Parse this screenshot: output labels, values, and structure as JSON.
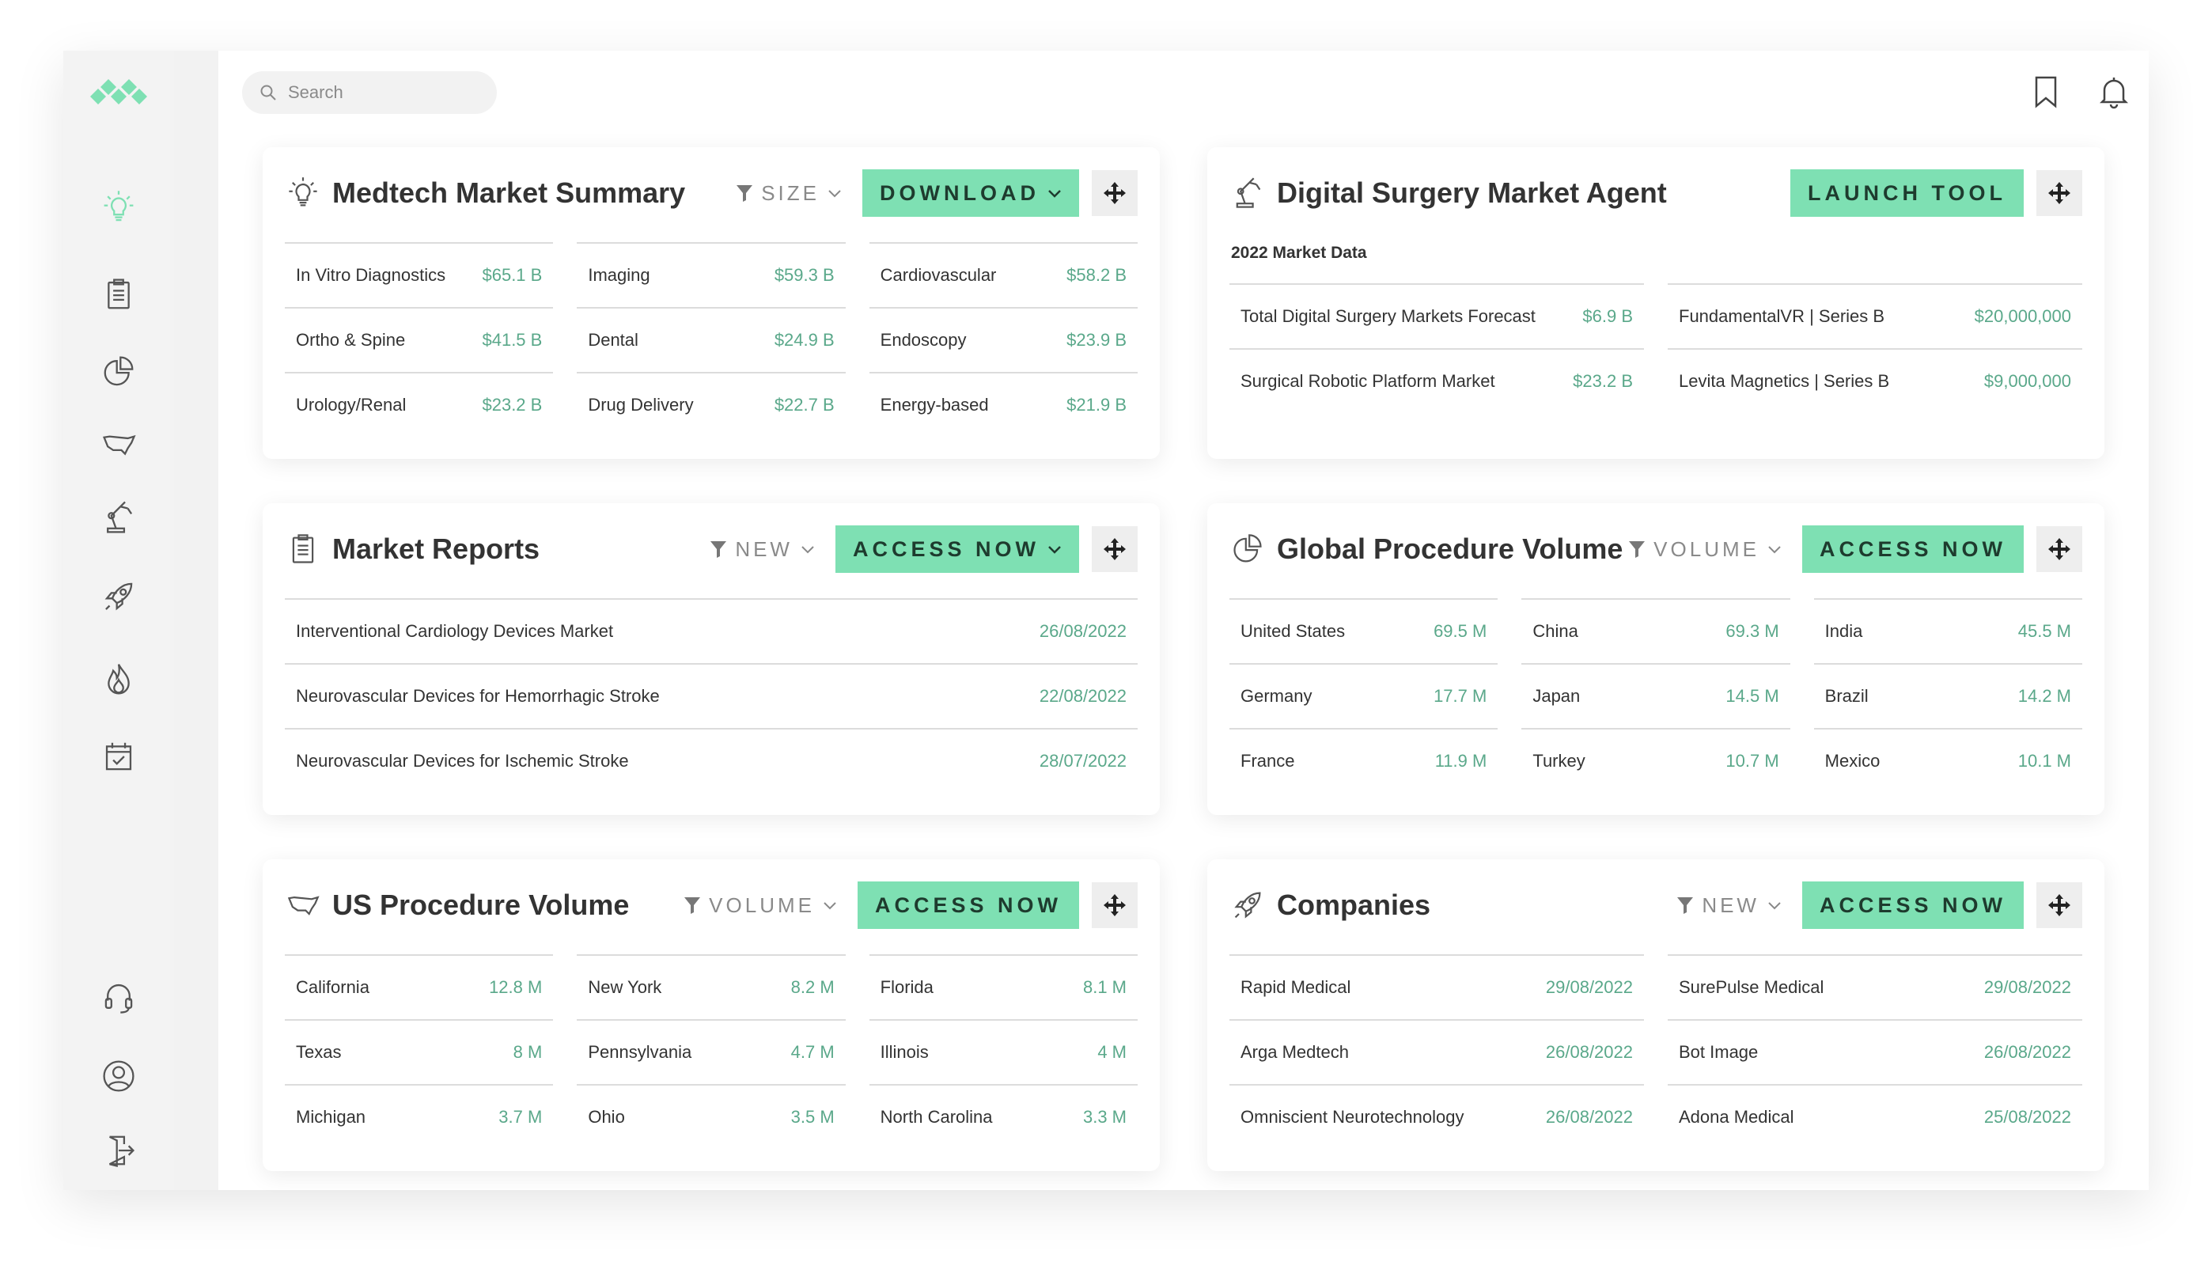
{
  "search": {
    "placeholder": "Search"
  },
  "brand_color": "#7ee0b3",
  "value_color": "#5aa88a",
  "sidebar": {
    "items": [
      {
        "icon": "lightbulb-icon"
      },
      {
        "icon": "clipboard-icon"
      },
      {
        "icon": "pie-chart-icon"
      },
      {
        "icon": "us-map-icon"
      },
      {
        "icon": "robot-arm-icon"
      },
      {
        "icon": "rocket-icon"
      },
      {
        "icon": "flame-icon"
      },
      {
        "icon": "calendar-check-icon"
      }
    ],
    "bottom": [
      {
        "icon": "headset-icon"
      },
      {
        "icon": "user-icon"
      },
      {
        "icon": "logout-icon"
      }
    ]
  },
  "header": {
    "icons": [
      "bookmark-icon",
      "bell-icon"
    ]
  },
  "cards": {
    "summary": {
      "title": "Medtech Market Summary",
      "filter": "SIZE",
      "button": "DOWNLOAD",
      "rows": [
        [
          {
            "label": "In Vitro Diagnostics",
            "value": "$65.1 B"
          },
          {
            "label": "Imaging",
            "value": "$59.3 B"
          },
          {
            "label": "Cardiovascular",
            "value": "$58.2 B"
          }
        ],
        [
          {
            "label": "Ortho & Spine",
            "value": "$41.5 B"
          },
          {
            "label": "Dental",
            "value": "$24.9 B"
          },
          {
            "label": "Endoscopy",
            "value": "$23.9 B"
          }
        ],
        [
          {
            "label": "Urology/Renal",
            "value": "$23.2 B"
          },
          {
            "label": "Drug Delivery",
            "value": "$22.7 B"
          },
          {
            "label": "Energy-based",
            "value": "$21.9 B"
          }
        ]
      ]
    },
    "surgery": {
      "title": "Digital Surgery Market Agent",
      "button": "LAUNCH TOOL",
      "subtitle": "2022 Market Data",
      "rows": [
        [
          {
            "label": "Total Digital Surgery Markets Forecast",
            "value": "$6.9 B"
          },
          {
            "label": "FundamentalVR | Series B",
            "value": "$20,000,000"
          }
        ],
        [
          {
            "label": "Surgical Robotic Platform Market",
            "value": "$23.2 B"
          },
          {
            "label": "Levita Magnetics | Series B",
            "value": "$9,000,000"
          }
        ]
      ]
    },
    "reports": {
      "title": "Market Reports",
      "filter": "NEW",
      "button": "ACCESS NOW",
      "rows": [
        [
          {
            "label": "Interventional Cardiology Devices Market",
            "value": "26/08/2022"
          }
        ],
        [
          {
            "label": "Neurovascular Devices for Hemorrhagic Stroke",
            "value": "22/08/2022"
          }
        ],
        [
          {
            "label": "Neurovascular Devices for Ischemic Stroke",
            "value": "28/07/2022"
          }
        ]
      ]
    },
    "global": {
      "title": "Global Procedure Volume",
      "filter": "VOLUME",
      "button": "ACCESS NOW",
      "rows": [
        [
          {
            "label": "United States",
            "value": "69.5 M"
          },
          {
            "label": "China",
            "value": "69.3 M"
          },
          {
            "label": "India",
            "value": "45.5 M"
          }
        ],
        [
          {
            "label": "Germany",
            "value": "17.7 M"
          },
          {
            "label": "Japan",
            "value": "14.5 M"
          },
          {
            "label": "Brazil",
            "value": "14.2 M"
          }
        ],
        [
          {
            "label": "France",
            "value": "11.9 M"
          },
          {
            "label": "Turkey",
            "value": "10.7 M"
          },
          {
            "label": "Mexico",
            "value": "10.1 M"
          }
        ]
      ]
    },
    "us": {
      "title": "US Procedure Volume",
      "filter": "VOLUME",
      "button": "ACCESS NOW",
      "rows": [
        [
          {
            "label": "California",
            "value": "12.8 M"
          },
          {
            "label": "New York",
            "value": "8.2 M"
          },
          {
            "label": "Florida",
            "value": "8.1 M"
          }
        ],
        [
          {
            "label": "Texas",
            "value": "8 M"
          },
          {
            "label": "Pennsylvania",
            "value": "4.7 M"
          },
          {
            "label": "Illinois",
            "value": "4 M"
          }
        ],
        [
          {
            "label": "Michigan",
            "value": "3.7 M"
          },
          {
            "label": "Ohio",
            "value": "3.5 M"
          },
          {
            "label": "North Carolina",
            "value": "3.3 M"
          }
        ]
      ]
    },
    "companies": {
      "title": "Companies",
      "filter": "NEW",
      "button": "ACCESS NOW",
      "rows": [
        [
          {
            "label": "Rapid Medical",
            "value": "29/08/2022"
          },
          {
            "label": "SurePulse Medical",
            "value": "29/08/2022"
          }
        ],
        [
          {
            "label": "Arga Medtech",
            "value": "26/08/2022"
          },
          {
            "label": "Bot Image",
            "value": "26/08/2022"
          }
        ],
        [
          {
            "label": "Omniscient Neurotechnology",
            "value": "26/08/2022"
          },
          {
            "label": "Adona Medical",
            "value": "25/08/2022"
          }
        ]
      ]
    }
  }
}
